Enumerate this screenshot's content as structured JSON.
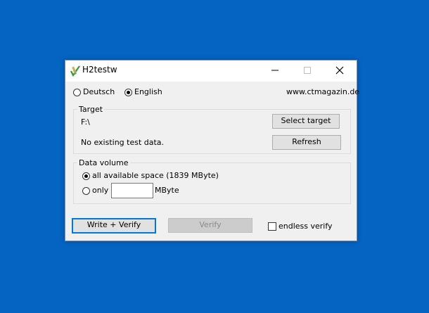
{
  "window": {
    "title": "H2testw",
    "icon": "pencil-check-icon"
  },
  "language": {
    "options": [
      "Deutsch",
      "English"
    ],
    "selected": "English",
    "website": "www.ctmagazin.de"
  },
  "target": {
    "group_title": "Target",
    "path": "F:\\",
    "status": "No existing test data.",
    "select_button": "Select target",
    "refresh_button": "Refresh"
  },
  "data_volume": {
    "group_title": "Data volume",
    "all_space_label": "all available space (1839 MByte)",
    "only_label": "only",
    "only_value": "",
    "unit_label": "MByte",
    "selected": "all available space"
  },
  "actions": {
    "write_verify": "Write + Verify",
    "verify": "Verify",
    "endless_verify_label": "endless verify",
    "endless_verify_checked": false
  },
  "colors": {
    "desktop": "#0563c1",
    "accent": "#0078d7"
  }
}
